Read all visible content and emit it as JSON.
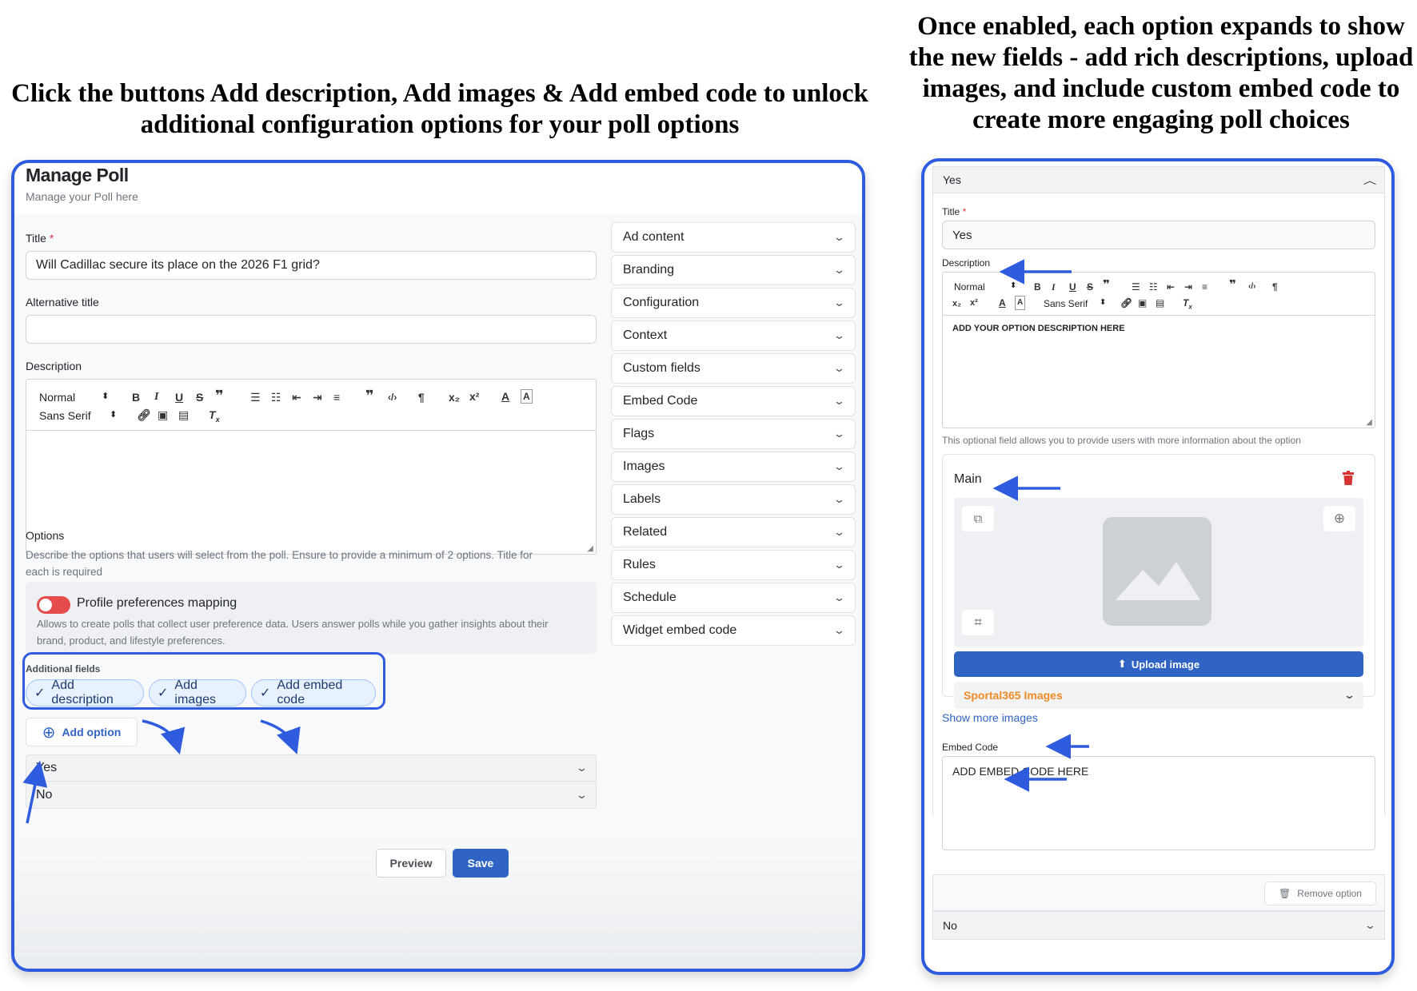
{
  "captions": {
    "left": "Click the buttons Add description, Add images & Add embed code to unlock additional configuration options for your poll options",
    "right": "Once enabled, each option expands to show the new fields - add rich descriptions, upload images, and include custom embed code to create more engaging poll choices"
  },
  "manage": {
    "title": "Manage Poll",
    "subtitle": "Manage your Poll here",
    "title_label": "Title",
    "required_mark": "*",
    "title_value": "Will Cadillac secure its place on the 2026 F1 grid?",
    "alt_title_label": "Alternative title",
    "alt_title_value": "",
    "description_label": "Description",
    "editor": {
      "size": "Normal",
      "font": "Sans Serif"
    },
    "options_label": "Options",
    "options_help": "Describe the options that users will select from the poll. Ensure to provide a minimum of 2 options. Title for each is required",
    "profile": {
      "label": "Profile preferences mapping",
      "help": "Allows to create polls that collect user preference data. Users answer polls while you gather insights about their brand, product, and lifestyle preferences.",
      "enabled": false
    },
    "additional_fields_label": "Additional fields",
    "chips": [
      "Add description",
      "Add images",
      "Add embed code"
    ],
    "add_option": "Add option",
    "options": [
      "Yes",
      "No"
    ],
    "preview": "Preview",
    "save": "Save"
  },
  "sidebar": {
    "sections": [
      "Ad content",
      "Branding",
      "Configuration",
      "Context",
      "Custom fields",
      "Embed Code",
      "Flags",
      "Images",
      "Labels",
      "Related",
      "Rules",
      "Schedule",
      "Widget embed code"
    ]
  },
  "option_panel": {
    "header": "Yes",
    "title_label": "Title",
    "title_value": "Yes",
    "description_label": "Description",
    "editor": {
      "size": "Normal",
      "font": "Sans Serif",
      "content": "ADD YOUR OPTION DESCRIPTION HERE"
    },
    "description_help": "This optional field allows you to provide users with more information about the option",
    "main_label": "Main",
    "upload_label": "Upload image",
    "images_source": "Sportal365 Images",
    "show_more": "Show more images",
    "embed_label": "Embed Code",
    "embed_value": "ADD EMBED CODE HERE",
    "remove_option": "Remove option",
    "next_option": "No"
  },
  "colors": {
    "frame": "#2f5bde",
    "primary": "#2f64c5",
    "arrow": "#2f5bde",
    "danger": "#d63333",
    "source": "#f08a24"
  }
}
